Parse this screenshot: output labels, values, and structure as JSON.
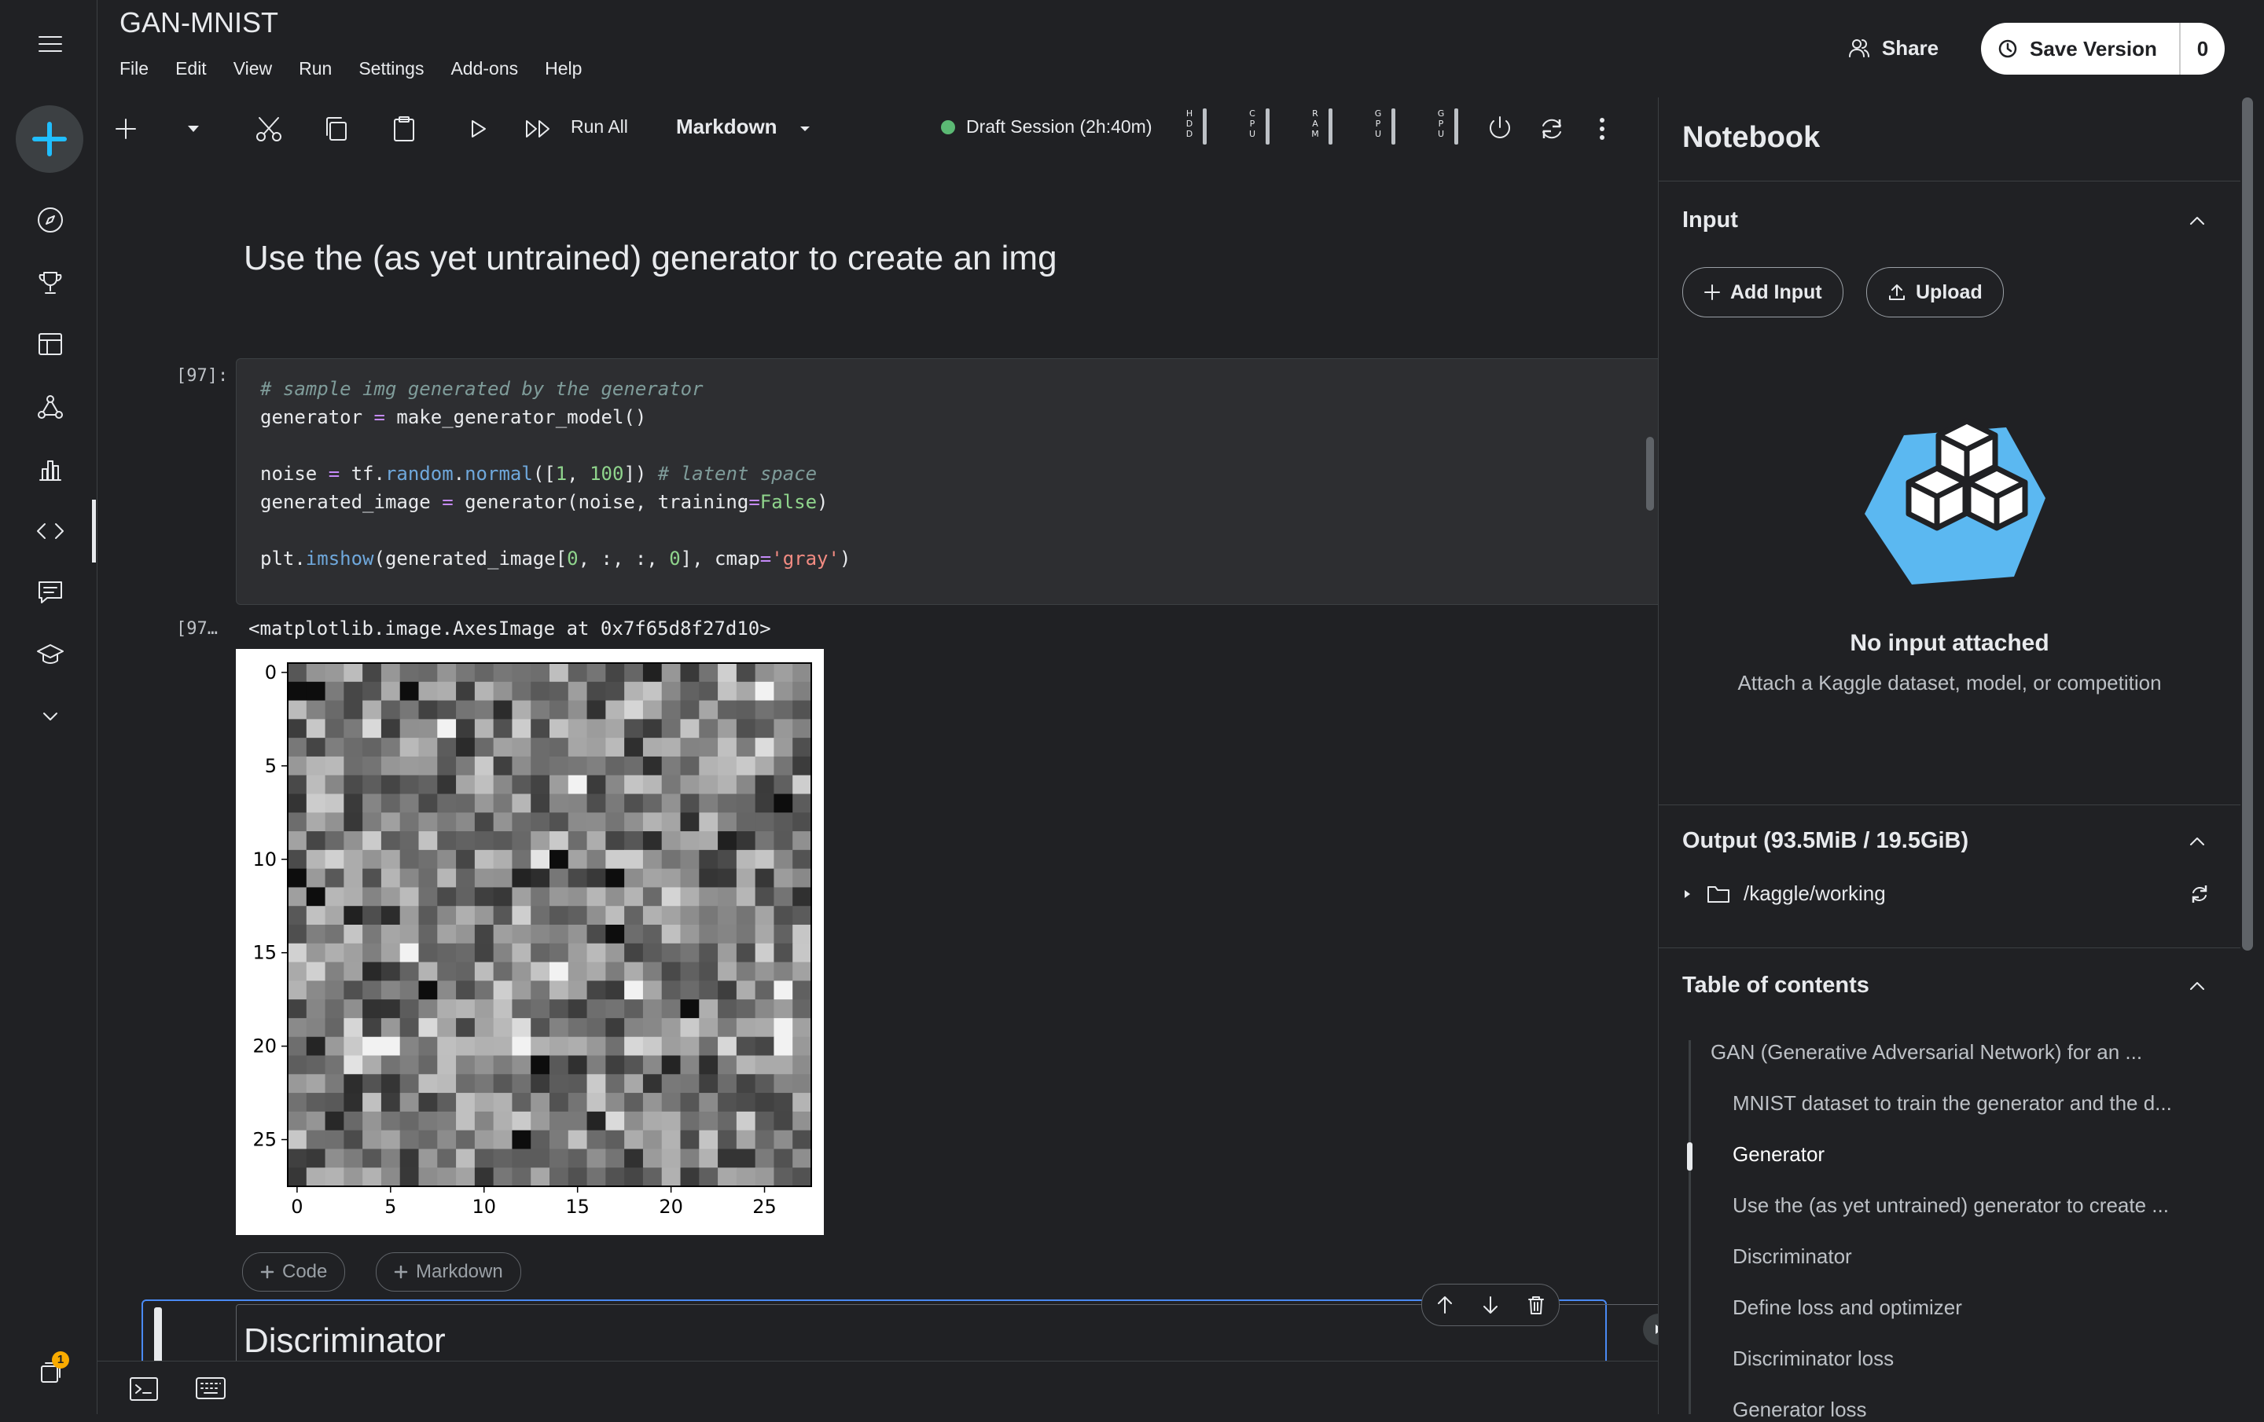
{
  "app": {
    "title": "GAN-MNIST"
  },
  "menu": [
    "File",
    "Edit",
    "View",
    "Run",
    "Settings",
    "Add-ons",
    "Help"
  ],
  "header": {
    "share_label": "Share",
    "save_label": "Save Version",
    "save_count": "0"
  },
  "toolbar": {
    "run_all_label": "Run All",
    "cell_type": "Markdown",
    "session_label": "Draft Session (2h:40m)",
    "meters": [
      "HDD",
      "CPU",
      "RAM",
      "GPU",
      "GPU"
    ]
  },
  "rail": {
    "icons": [
      "menu-icon",
      "create-icon",
      "compass-icon",
      "trophy-icon",
      "table-icon",
      "models-icon",
      "chart-icon",
      "code-icon",
      "discussion-icon",
      "learn-icon",
      "more-icon"
    ],
    "notification_count": "1"
  },
  "notebook": {
    "heading": "Use the (as yet untrained) generator to create an img",
    "cell_prompt": "[97]:",
    "code": [
      "# sample img generated by the generator",
      "generator = make_generator_model()",
      "",
      "noise = tf.random.normal([1, 100]) # latent space",
      "generated_image = generator(noise, training=False)",
      "",
      "plt.imshow(generated_image[0, :, :, 0], cmap='gray')"
    ],
    "output_prompt": "[97…",
    "output_text": "<matplotlib.image.AxesImage at 0x7f65d8f27d10>",
    "add_code_label": "Code",
    "add_markdown_label": "Markdown",
    "next_heading": "Discriminator"
  },
  "chart_data": {
    "type": "heatmap",
    "title": "",
    "xlabel": "",
    "ylabel": "",
    "grid_size": [
      28,
      28
    ],
    "colormap": "gray",
    "x_ticks": [
      "0",
      "5",
      "10",
      "15",
      "20",
      "25"
    ],
    "y_ticks": [
      "0",
      "5",
      "10",
      "15",
      "20",
      "25"
    ],
    "xlim": [
      -0.5,
      27.5
    ],
    "ylim": [
      27.5,
      -0.5
    ],
    "note_values": "random noise values, near mid-gray"
  },
  "panel": {
    "title": "Notebook",
    "input": {
      "title": "Input",
      "add_input_label": "Add Input",
      "upload_label": "Upload",
      "empty_title": "No input attached",
      "empty_sub": "Attach a Kaggle dataset, model, or competition"
    },
    "output": {
      "title": "Output (93.5MiB / 19.5GiB)",
      "folder": "/kaggle/working"
    },
    "toc": {
      "title": "Table of contents",
      "items": [
        {
          "label": "GAN (Generative Adversarial Network) for an ...",
          "level": 1
        },
        {
          "label": "MNIST dataset to train the generator and the d...",
          "level": 2
        },
        {
          "label": "Generator",
          "level": 2
        },
        {
          "label": "Use the (as yet untrained) generator to create ...",
          "level": 2
        },
        {
          "label": "Discriminator",
          "level": 2
        },
        {
          "label": "Define loss and optimizer",
          "level": 2
        },
        {
          "label": "Discriminator loss",
          "level": 2
        },
        {
          "label": "Generator loss",
          "level": 2
        }
      ]
    }
  }
}
